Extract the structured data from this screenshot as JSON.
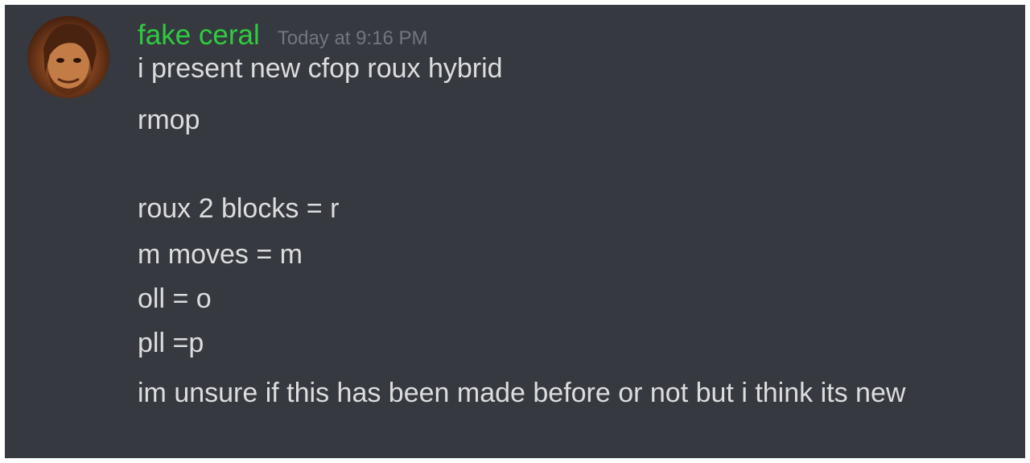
{
  "message": {
    "username": "fake ceral",
    "username_color": "#2ecc40",
    "timestamp": "Today at 9:16 PM",
    "lines": [
      "i present new cfop roux hybrid",
      "rmop",
      "roux 2 blocks = r",
      "m moves = m",
      "oll = o",
      "pll =p",
      "im unsure if this has been made before or not but i think its new"
    ]
  },
  "colors": {
    "background": "#36393f",
    "text": "#dcddde",
    "muted": "#72767d"
  }
}
